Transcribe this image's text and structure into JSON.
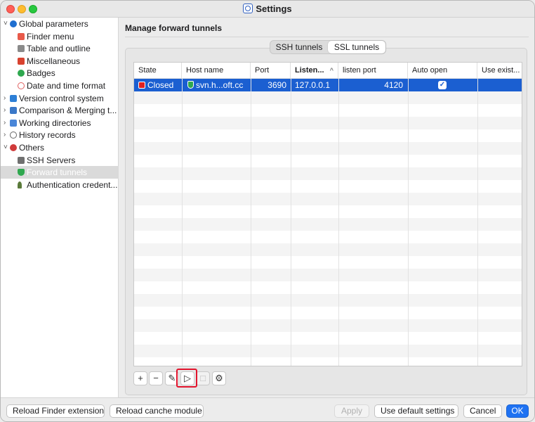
{
  "window": {
    "title": "Settings"
  },
  "sidebar": {
    "items": [
      {
        "label": "Global parameters",
        "icon": "gear-icon",
        "expander": "˅",
        "color": "#1f6fd0"
      },
      {
        "label": "Finder menu",
        "icon": "finder-menu-icon",
        "color": "#e85a4a"
      },
      {
        "label": "Table and outline",
        "icon": "table-icon",
        "color": "#8a8a8a"
      },
      {
        "label": "Miscellaneous",
        "icon": "grid-icon",
        "color": "#d8422f"
      },
      {
        "label": "Badges",
        "icon": "check-circle-icon",
        "color": "#2fa84f"
      },
      {
        "label": "Date and time format",
        "icon": "clock-icon",
        "color": "#e06060"
      },
      {
        "label": "Version control system",
        "icon": "layers-icon",
        "expander": "›",
        "color": "#2d7fd6"
      },
      {
        "label": "Comparison & Merging t...",
        "icon": "compare-icon",
        "expander": "›",
        "color": "#3a78c8"
      },
      {
        "label": "Working directories",
        "icon": "folder-icon",
        "expander": "›",
        "color": "#4a86d8"
      },
      {
        "label": "History records",
        "icon": "history-icon",
        "expander": "›",
        "color": "#666666"
      },
      {
        "label": "Others",
        "icon": "others-icon",
        "expander": "˅",
        "color": "#d03a3a"
      },
      {
        "label": "SSH Servers",
        "icon": "server-icon",
        "color": "#707070"
      },
      {
        "label": "Forward tunnels",
        "icon": "shield-icon",
        "color": "#2fa84f"
      },
      {
        "label": "Authentication credent...",
        "icon": "key-icon",
        "color": "#5a7a3a"
      }
    ]
  },
  "main": {
    "title": "Manage forward tunnels",
    "tabs": [
      {
        "label": "SSH tunnels",
        "active": false
      },
      {
        "label": "SSL tunnels",
        "active": true
      }
    ],
    "table": {
      "columns": [
        "State",
        "Host name",
        "Port",
        "Listen...",
        "listen port",
        "Auto open",
        "Use exist..."
      ],
      "sorted_column": "Listen...",
      "sort_glyph": "^",
      "rows": [
        {
          "state": "Closed",
          "host": "svn.h...oft.cc",
          "port": "3690",
          "listen": "127.0.0.1",
          "listen_port": "4120",
          "auto_open": true,
          "check": "✓"
        }
      ]
    },
    "toolbar": {
      "add": "+",
      "remove": "−",
      "edit": "✎",
      "start": "▷",
      "stop": "□",
      "settings": "⚙"
    }
  },
  "bottom": {
    "reload_finder": "Reload Finder extension",
    "reload_cache": "Reload canche module",
    "apply": "Apply",
    "use_default": "Use default settings",
    "cancel": "Cancel",
    "ok": "OK"
  },
  "colors": {
    "selection": "#1b5fd1",
    "primary_button": "#1f72f2",
    "highlight": "#e2142d",
    "state_closed": "#e02020"
  }
}
